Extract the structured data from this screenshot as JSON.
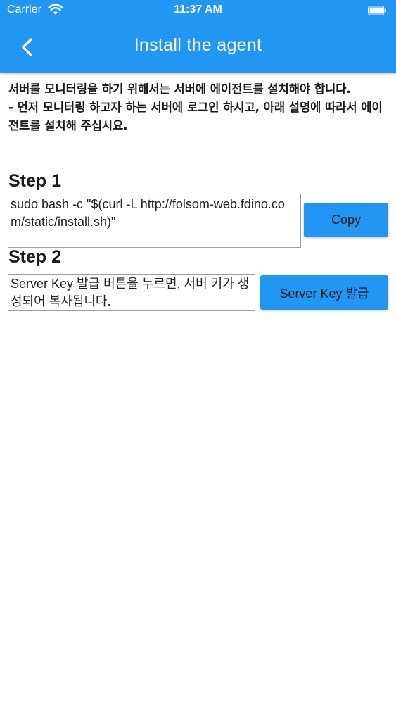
{
  "status_bar": {
    "carrier": "Carrier",
    "time": "11:37 AM",
    "icons": [
      "wifi-icon",
      "battery-icon"
    ]
  },
  "app_bar": {
    "title": "Install the agent",
    "back_icon": "chevron-left-icon",
    "color": "#2196F3"
  },
  "intro_text": "서버를 모니터링을 하기 위해서는 서버에 에이전트를 설치해야 합니다.\n- 먼저 모니터링 하고자 하는 서버에 로그인 하시고, 아래 설명에 따라서 에이전트를 설치해 주십시요.",
  "step1": {
    "title": "Step 1",
    "command": "sudo bash -c \"$(curl -L http://folsom-web.fdino.com/static/install.sh)\"",
    "button_label": "Copy"
  },
  "step2": {
    "title": "Step 2",
    "placeholder": "Server Key 발급 버튼을 누르면, 서버 키가 생성되어 복사됩니다.",
    "button_label": "Server Key 발급"
  }
}
